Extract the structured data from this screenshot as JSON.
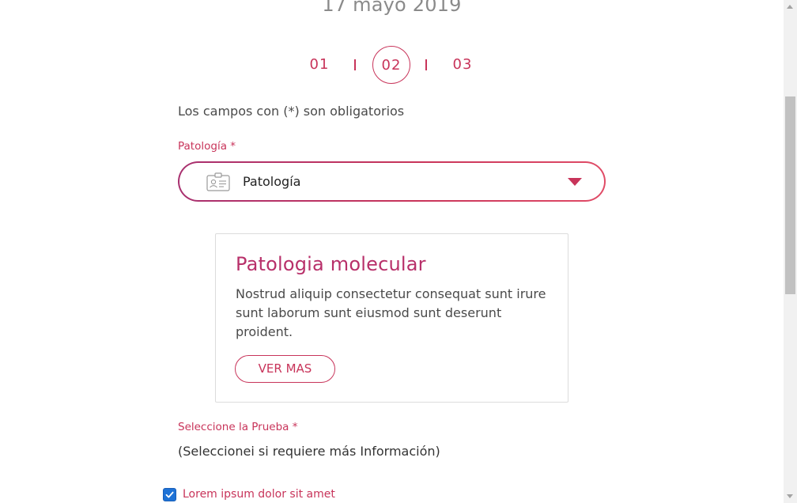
{
  "header": {
    "date": "17 mayo 2019"
  },
  "stepper": {
    "steps": [
      "01",
      "02",
      "03"
    ],
    "active_step": "02"
  },
  "form": {
    "required_note": "Los campos con (*) son obligatorios",
    "pathology": {
      "label": "Patología *",
      "selected_value": "Patología",
      "icon": "id-card-icon"
    },
    "test": {
      "label": "Seleccione la Prueba *",
      "hint": "(Seleccionei si requiere más Información)"
    },
    "checkbox": {
      "label": "Lorem ipsum dolor sit amet",
      "checked": true
    }
  },
  "card": {
    "title": "Patologia molecular",
    "body": "Nostrud aliquip consectetur consequat sunt irure sunt laborum sunt eiusmod sunt deserunt proident.",
    "button_label": "VER MAS"
  },
  "colors": {
    "accent": "#c8345a",
    "accent_dark": "#a8306f",
    "checkbox": "#1e72d6"
  }
}
